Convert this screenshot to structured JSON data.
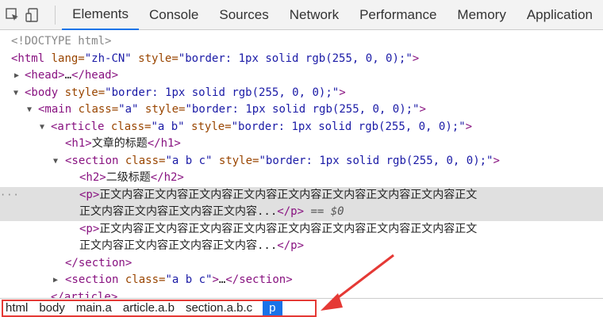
{
  "toolbar": {
    "tabs": [
      "Elements",
      "Console",
      "Sources",
      "Network",
      "Performance",
      "Memory",
      "Application"
    ]
  },
  "tree": {
    "l0": "<!DOCTYPE html>",
    "l1": {
      "open": "<html",
      "attr1": " lang=",
      "val1": "\"zh-CN\"",
      "attr2": " style=",
      "val2": "\"border: 1px solid rgb(255, 0, 0);\"",
      "close": ">"
    },
    "l2": {
      "open": "<head>",
      "dots": "…",
      "close": "</head>"
    },
    "l3": {
      "open": "<body",
      "attr1": " style=",
      "val1": "\"border: 1px solid rgb(255, 0, 0);\"",
      "close": ">"
    },
    "l4": {
      "open": "<main",
      "attr1": " class=",
      "val1": "\"a\"",
      "attr2": " style=",
      "val2": "\"border: 1px solid rgb(255, 0, 0);\"",
      "close": ">"
    },
    "l5": {
      "open": "<article",
      "attr1": " class=",
      "val1": "\"a b\"",
      "attr2": " style=",
      "val2": "\"border: 1px solid rgb(255, 0, 0);\"",
      "close": ">"
    },
    "l6": {
      "open": "<h1>",
      "text": "文章的标题",
      "close": "</h1>"
    },
    "l7": {
      "open": "<section",
      "attr1": " class=",
      "val1": "\"a b c\"",
      "attr2": " style=",
      "val2": "\"border: 1px solid rgb(255, 0, 0);\"",
      "close": ">"
    },
    "l8": {
      "open": "<h2>",
      "text": "二级标题",
      "close": "</h2>"
    },
    "l9": {
      "open": "<p>",
      "text": "正文内容正文内容正文内容正文内容正文内容正文内容正文内容正文内容正文"
    },
    "l10": {
      "text": "正文内容正文内容正文内容正文内容...",
      "close": "</p>",
      "eq": " == $0"
    },
    "l11": {
      "open": "<p>",
      "text": "正文内容正文内容正文内容正文内容正文内容正文内容正文内容正文内容正文"
    },
    "l12": {
      "text": "正文内容正文内容正文内容正文内容...",
      "close": "</p>"
    },
    "l13": {
      "close": "</section>"
    },
    "l14": {
      "open": "<section",
      "attr1": " class=",
      "val1": "\"a b c\"",
      "close": ">",
      "dots": "…",
      "close2": "</section>"
    },
    "l15": {
      "close": "</article>"
    },
    "ellipsis": "···"
  },
  "breadcrumb": {
    "items": [
      "html",
      "body",
      "main.a",
      "article.a.b",
      "section.a.b.c"
    ],
    "active": "p"
  },
  "colors": {
    "annotation": "#e53935",
    "accent": "#1a73e8"
  }
}
